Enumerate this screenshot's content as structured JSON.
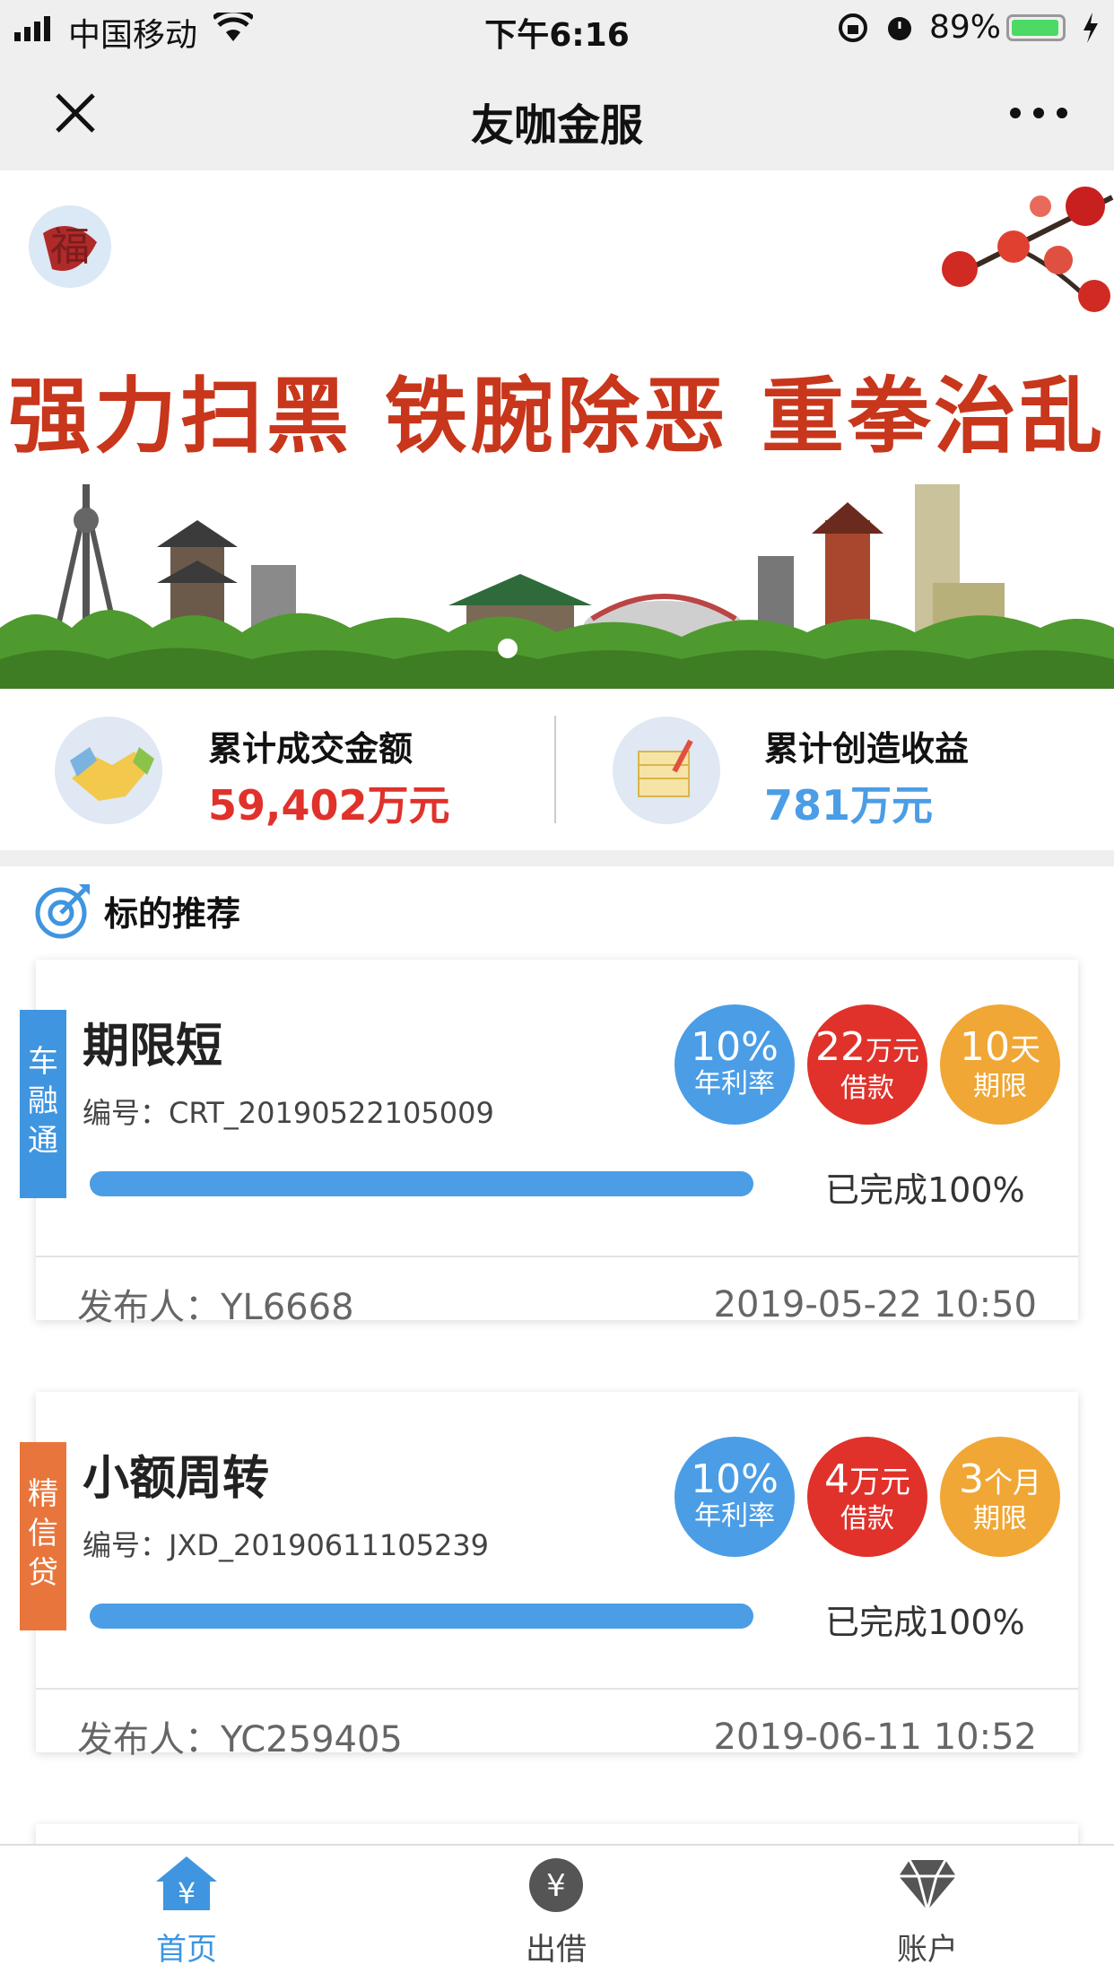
{
  "status_bar": {
    "carrier": "中国移动",
    "time": "下午6:16",
    "battery": "89%"
  },
  "nav": {
    "title": "友咖金服"
  },
  "banner": {
    "slogan": "强力扫黑  铁腕除恶  重拳治乱"
  },
  "stats": [
    {
      "label": "累计成交金额",
      "value": "59,402万元",
      "color": "#e0312b",
      "icon": "handshake-icon"
    },
    {
      "label": "累计创造收益",
      "value": "781万元",
      "color": "#4b9de6",
      "icon": "calendar-pen-icon"
    }
  ],
  "section": {
    "title": "标的推荐",
    "icon": "target-icon"
  },
  "loans": [
    {
      "tag": "车融通",
      "tag_color": "#3f95df",
      "title": "期限短",
      "code": "编号：CRT_20190522105009",
      "rate_value": "10%",
      "rate_label": "年利率",
      "amount_value": "22",
      "amount_unit": "万元",
      "amount_label": "借款",
      "term_value": "10",
      "term_unit": "天",
      "term_label": "期限",
      "progress_percent": 100,
      "progress_text": "已完成100%",
      "publisher": "发布人：YL6668",
      "date": "2019-05-22 10:50"
    },
    {
      "tag": "精信贷",
      "tag_color": "#e8763c",
      "title": "小额周转",
      "code": "编号：JXD_20190611105239",
      "rate_value": "10%",
      "rate_label": "年利率",
      "amount_value": "4",
      "amount_unit": "万元",
      "amount_label": "借款",
      "term_value": "3",
      "term_unit": "个月",
      "term_label": "期限",
      "progress_percent": 100,
      "progress_text": "已完成100%",
      "publisher": "发布人：YC259405",
      "date": "2019-06-11 10:52"
    }
  ],
  "colors": {
    "blue": "#3f95df",
    "red": "#e0312b",
    "orange": "#f0a735"
  },
  "tabs": [
    {
      "label": "首页",
      "icon": "home-yen-icon",
      "active": true
    },
    {
      "label": "出借",
      "icon": "yen-coin-icon",
      "active": false
    },
    {
      "label": "账户",
      "icon": "diamond-icon",
      "active": false
    }
  ]
}
